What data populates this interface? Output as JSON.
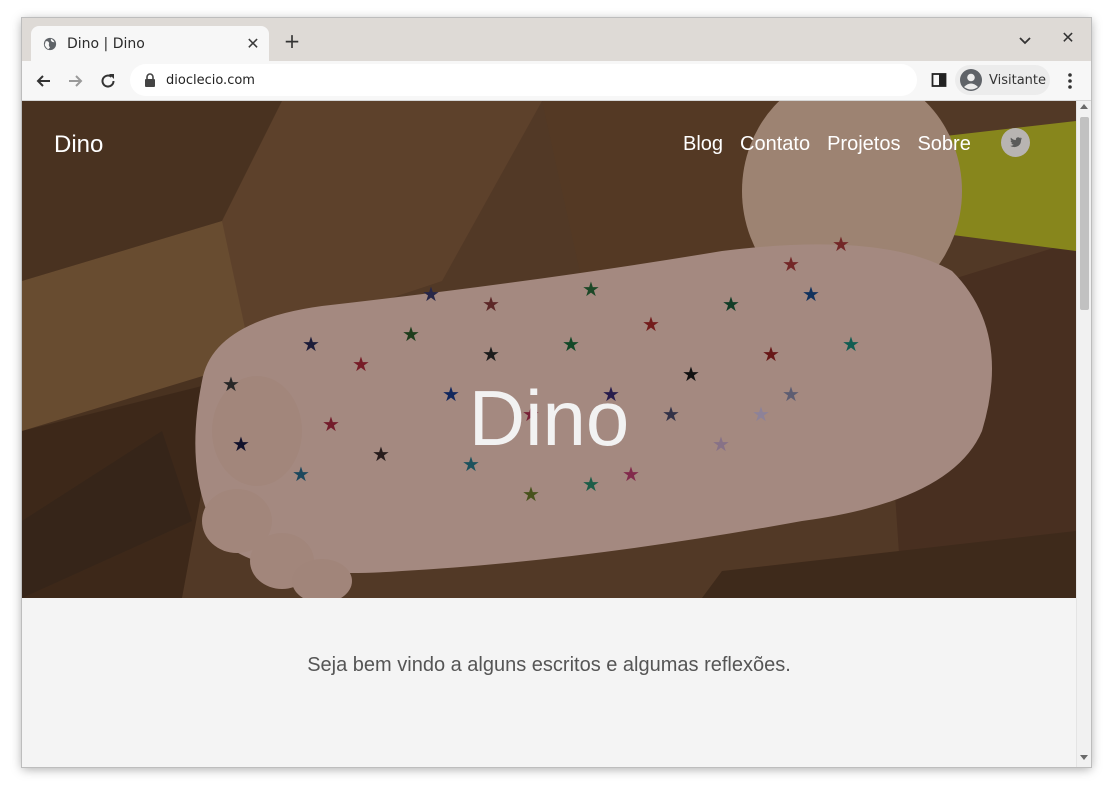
{
  "browser": {
    "tab": {
      "title": "Dino | Dino",
      "favicon": "globe-icon",
      "close_glyph": "✕"
    },
    "new_tab_glyph": "+",
    "window_close_glyph": "✕",
    "address_bar": {
      "url": "dioclecio.com"
    },
    "profile": {
      "name": "Visitante"
    }
  },
  "site": {
    "brand": "Dino",
    "nav": [
      {
        "label": "Blog"
      },
      {
        "label": "Contato"
      },
      {
        "label": "Projetos"
      },
      {
        "label": "Sobre"
      }
    ],
    "social": {
      "icon": "twitter-icon"
    },
    "hero": {
      "title": "Dino"
    },
    "tagline": "Seja bem vindo a alguns escritos e algumas reflexões."
  },
  "colors": {
    "tab_strip": "#dedad6",
    "toolbar": "#f7f7f7",
    "page_bg": "#f4f4f4",
    "tagline_text": "#555555"
  }
}
